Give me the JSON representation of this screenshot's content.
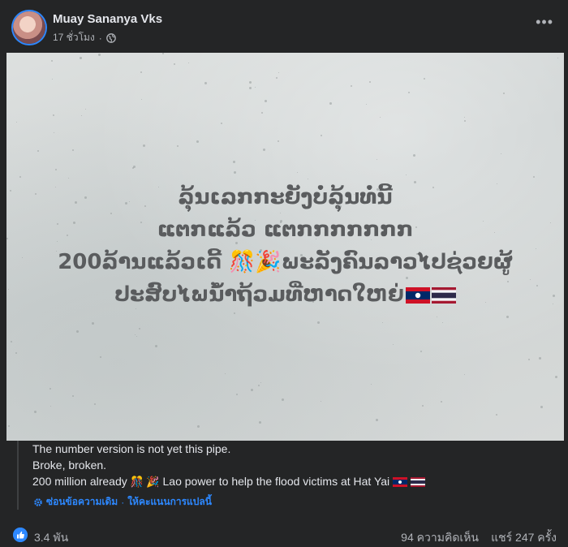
{
  "post": {
    "author": "Muay Sananya Vks",
    "time": "17 ชั่วโมง",
    "privacy_icon": "globe-icon",
    "menu_icon": "more-options-icon"
  },
  "image": {
    "lines": [
      "ລຸ້ນເລກກະຍັງບໍ່ລຸ້ນທໍ່ນີ້",
      "ແຕກແລ້ວ ແຕກກກກກກກ",
      "200ລ້ານແລ້ວເດີ້ 🎊🎉ພະລັງຄົນລາວໄປຊ່ວຍຜູ້",
      "ປະສົບໄພນໍ້າຖ້ວມທີ່ຫາດໃຫຍ່"
    ],
    "flags": [
      "laos-flag-icon",
      "thailand-flag-icon"
    ]
  },
  "translation": {
    "line1": "The number version is not yet this pipe.",
    "line2": "Broke, broken.",
    "line3_a": "200 million already",
    "line3_emoji": "🎊 🎉",
    "line3_b": "Lao power to help the flood victims at Hat Yai",
    "hide_original": "ซ่อนข้อความเดิม",
    "separator": "·",
    "rate_translation": "ให้คะแนนการแปลนี้"
  },
  "stats": {
    "reactions": "3.4 พัน",
    "comments": "94 ความคิดเห็น",
    "shares": "แชร์ 247 ครั้ง"
  },
  "colors": {
    "background": "#242526",
    "text": "#e4e6eb",
    "secondary_text": "#b0b3b8",
    "accent": "#2d88ff"
  }
}
